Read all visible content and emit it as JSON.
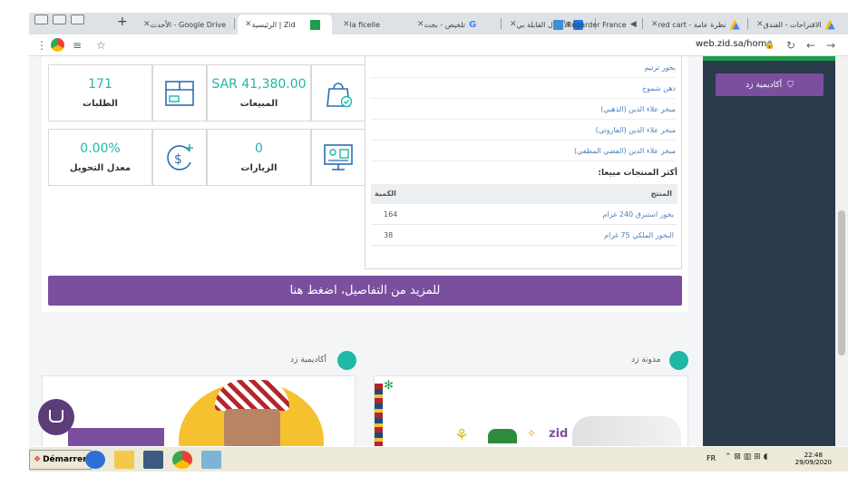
{
  "browser": {
    "tabs": [
      {
        "title": "الأحدث - Google Drive"
      },
      {
        "title": "الرئيسية | Zid"
      },
      {
        "title": "la ficelle"
      },
      {
        "title": "تلخيص - بحث"
      },
      {
        "title": "الأعمال القابلة بي"
      },
      {
        "title": "Regarder France"
      },
      {
        "title": "red cart - نظرة عامة"
      },
      {
        "title": "الاقتراحات - الفندق"
      }
    ],
    "url": "web.zid.sa/home"
  },
  "stats": {
    "orders": {
      "value": "171",
      "label": "الطلبات"
    },
    "sales": {
      "value": "SAR 41,380.00",
      "label": "المبيعات"
    },
    "conversion": {
      "value": "0.00%",
      "label": "معدل التحويل"
    },
    "visits": {
      "value": "0",
      "label": "الزيارات"
    }
  },
  "products_list": [
    "بخور ترتيم",
    "دهن شموخ",
    "مبخر علاء الدين (الذهبي)",
    "مبخر علاء الدين (الفاروتي)",
    "مبخر علاء الدين (الفضي المطفي)"
  ],
  "top_products": {
    "title": "أكثر المنتجات مبيعا:",
    "col_product": "المنتج",
    "col_qty": "الكمية",
    "rows": [
      {
        "name": "بخور استبرق 240 غرام",
        "qty": "164"
      },
      {
        "name": "البخور الملكي 75 غرام",
        "qty": "38"
      }
    ]
  },
  "more_button": "للمزيد من التفاصيل، اضغط هنا",
  "sections": {
    "academy": "أكاديمية زد",
    "blog": "مدونة زد"
  },
  "sidebar": {
    "academy_button": "أكاديمية زد"
  },
  "blog_card": {
    "brand": "zid"
  },
  "taskbar": {
    "start": "Démarrer",
    "lang": "FR",
    "time": "22:48",
    "date": "29/09/2020"
  },
  "colors": {
    "accent_teal": "#1fb7a6",
    "accent_purple": "#7b4f9e",
    "sidebar": "#2a3b4c"
  }
}
